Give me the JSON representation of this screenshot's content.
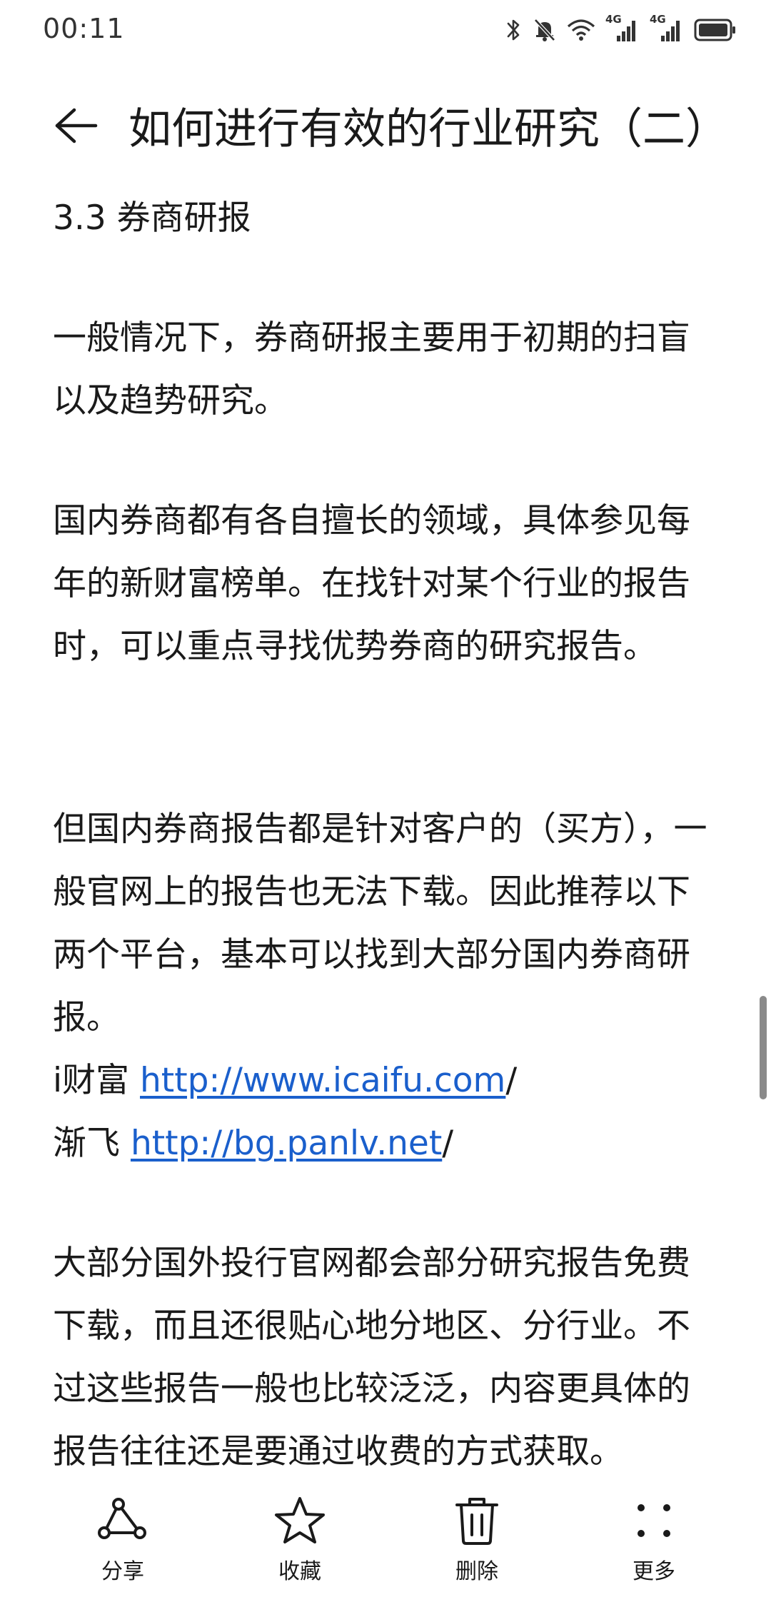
{
  "status_bar": {
    "time": "00:11",
    "icons": [
      "bluetooth-icon",
      "mute-icon",
      "wifi-icon",
      "signal-4g-icon",
      "signal-4g-icon",
      "battery-icon"
    ],
    "network_label_1": "4G",
    "network_label_2": "4G"
  },
  "header": {
    "title": "如何进行有效的行业研究（二）"
  },
  "article": {
    "section_heading": "3.3 券商研报",
    "para1": "一般情况下，券商研报主要用于初期的扫盲以及趋势研究。",
    "para2": "国内券商都有各自擅长的领域，具体参见每年的新财富榜单。在找针对某个行业的报告时，可以重点寻找优势券商的研究报告。",
    "para3": "但国内券商报告都是针对客户的（买方），一般官网上的报告也无法下载。因此推荐以下两个平台，基本可以找到大部分国内券商研报。",
    "link1_prefix": "i财富 ",
    "link1_url": "http://www.icaifu.com",
    "link1_suffix": "/",
    "link2_prefix": "渐飞 ",
    "link2_url": "http://bg.panlv.net",
    "link2_suffix": "/",
    "para4": "大部分国外投行官网都会部分研究报告免费下载，而且还很贴心地分地区、分行业。不过这些报告一般也比较泛泛，内容更具体的报告往往还是要通过收费的方式获取。"
  },
  "toolbar": {
    "share_label": "分享",
    "favorite_label": "收藏",
    "delete_label": "删除",
    "more_label": "更多"
  }
}
